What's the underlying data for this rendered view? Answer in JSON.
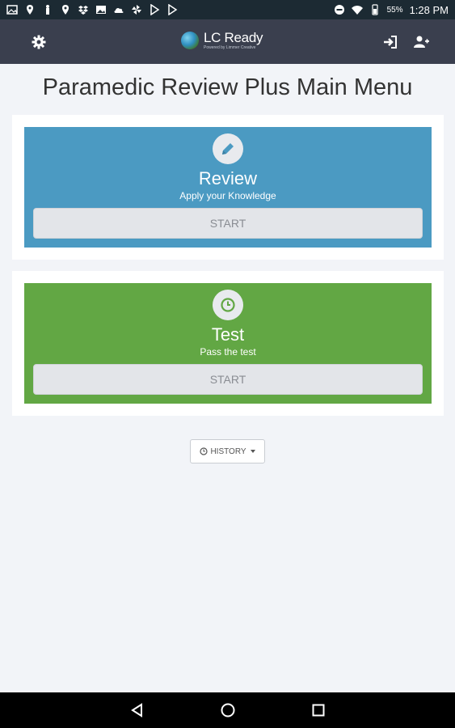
{
  "status_bar": {
    "battery": "55%",
    "time": "1:28 PM"
  },
  "header": {
    "logo_text": "LC Ready",
    "logo_sub": "Powered by Limmer Creative"
  },
  "page_title": "Paramedic Review Plus Main Menu",
  "cards": [
    {
      "title": "Review",
      "subtitle": "Apply your Knowledge",
      "button": "START",
      "color": "#4b9ac2",
      "icon": "pencil-icon"
    },
    {
      "title": "Test",
      "subtitle": "Pass the test",
      "button": "START",
      "color": "#62a744",
      "icon": "clock-icon"
    }
  ],
  "history_button": "HISTORY"
}
